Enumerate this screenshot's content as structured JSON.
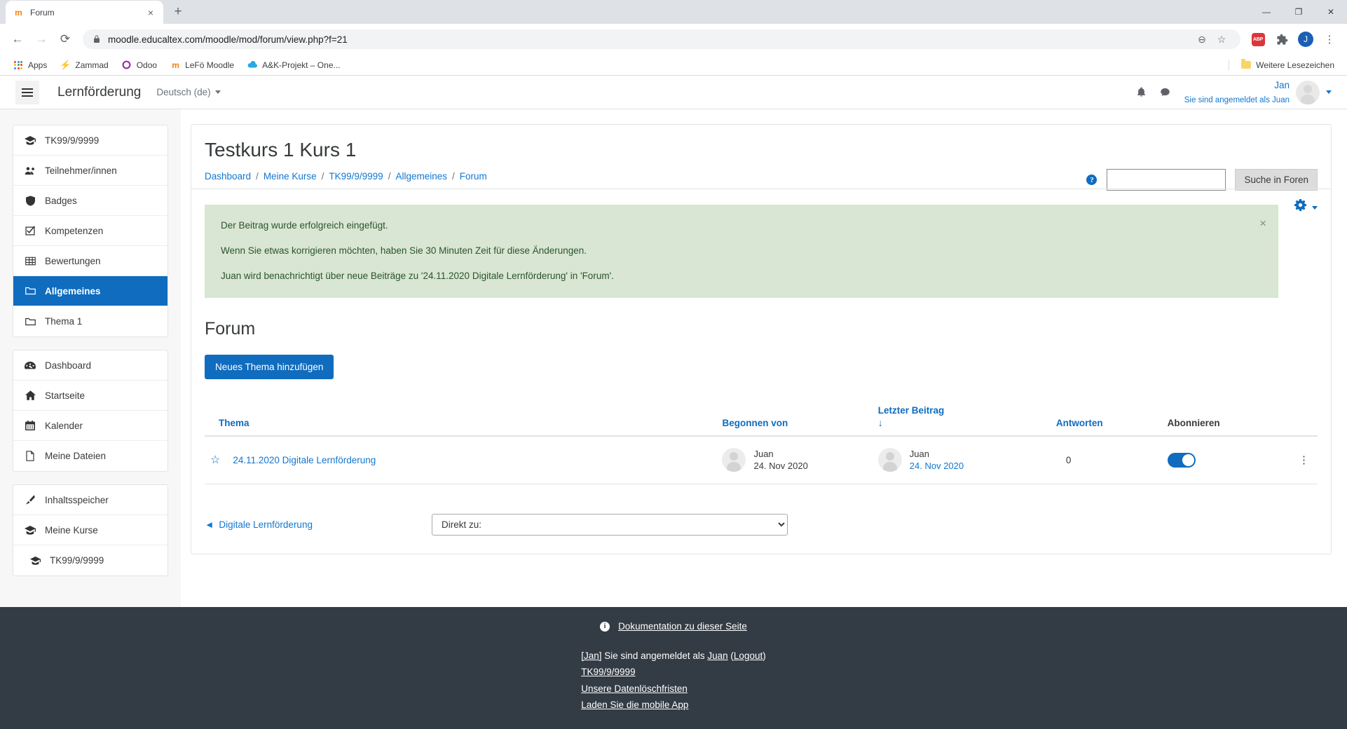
{
  "browser": {
    "tab": {
      "title": "Forum",
      "favicon": "moodle-m-icon",
      "close": "×"
    },
    "new_tab_label": "+",
    "window_controls": {
      "minimize": "—",
      "maximize": "❐",
      "close": "✕"
    },
    "nav": {
      "back": "←",
      "forward": "→",
      "reload": "⟳"
    },
    "url": "moodle.educaltex.com/moodle/mod/forum/view.php?f=21",
    "url_domain": "moodle.educaltex.com",
    "url_path": "/moodle/mod/forum/view.php?f=21",
    "omnibox_icons": {
      "lock": "lock-icon",
      "zoom_out": "⊖",
      "bookmark_star": "☆"
    },
    "toolbar_icons": {
      "adblock": "ABP",
      "extensions": "puzzle-icon",
      "profile": "J",
      "menu": "⋮"
    },
    "bookmarks": [
      {
        "label": "Apps",
        "icon": "apps-grid-icon"
      },
      {
        "label": "Zammad",
        "icon": "zammad-icon"
      },
      {
        "label": "Odoo",
        "icon": "odoo-icon"
      },
      {
        "label": "LeFö Moodle",
        "icon": "moodle-m-icon"
      },
      {
        "label": "A&K-Projekt – One...",
        "icon": "onedrive-cloud-icon"
      }
    ],
    "bookmarks_more": {
      "label": "Weitere Lesezeichen",
      "icon": "folder-icon"
    }
  },
  "navbar": {
    "menu_toggle": "hamburger-icon",
    "brand": "Lernförderung",
    "language": "Deutsch (de)",
    "notifications_icon": "bell-icon",
    "messages_icon": "chat-bubble-icon",
    "user_name": "Jan",
    "user_sub": "Sie sind angemeldet als Juan"
  },
  "sidebar": {
    "blocks": [
      {
        "items": [
          {
            "label": "TK99/9/9999",
            "icon": "graduation-cap-icon",
            "active": false,
            "sub": false
          },
          {
            "label": "Teilnehmer/innen",
            "icon": "users-icon",
            "active": false,
            "sub": false
          },
          {
            "label": "Badges",
            "icon": "shield-icon",
            "active": false,
            "sub": false
          },
          {
            "label": "Kompetenzen",
            "icon": "check-square-icon",
            "active": false,
            "sub": false
          },
          {
            "label": "Bewertungen",
            "icon": "table-icon",
            "active": false,
            "sub": false
          },
          {
            "label": "Allgemeines",
            "icon": "folder-open-icon",
            "active": true,
            "sub": false
          },
          {
            "label": "Thema 1",
            "icon": "folder-open-icon",
            "active": false,
            "sub": false
          }
        ]
      },
      {
        "items": [
          {
            "label": "Dashboard",
            "icon": "dashboard-icon",
            "active": false,
            "sub": false
          },
          {
            "label": "Startseite",
            "icon": "home-icon",
            "active": false,
            "sub": false
          },
          {
            "label": "Kalender",
            "icon": "calendar-icon",
            "active": false,
            "sub": false
          },
          {
            "label": "Meine Dateien",
            "icon": "file-icon",
            "active": false,
            "sub": false
          }
        ]
      },
      {
        "items": [
          {
            "label": "Inhaltsspeicher",
            "icon": "brush-icon",
            "active": false,
            "sub": false
          },
          {
            "label": "Meine Kurse",
            "icon": "graduation-cap-icon",
            "active": false,
            "sub": false
          },
          {
            "label": "TK99/9/9999",
            "icon": "graduation-cap-icon",
            "active": false,
            "sub": true
          }
        ]
      }
    ]
  },
  "main": {
    "page_title": "Testkurs 1 Kurs 1",
    "breadcrumb": [
      "Dashboard",
      "Meine Kurse",
      "TK99/9/9999",
      "Allgemeines",
      "Forum"
    ],
    "breadcrumb_separator": "/",
    "search": {
      "help_icon": "?",
      "value": "",
      "placeholder": "",
      "button_label": "Suche in Foren"
    },
    "gear": {
      "icon": "gear-icon",
      "caret": "▾"
    },
    "alert": {
      "close_label": "×",
      "lines": [
        "Der Beitrag wurde erfolgreich eingefügt.",
        "Wenn Sie etwas korrigieren möchten, haben Sie 30 Minuten Zeit für diese Änderungen.",
        "Juan wird benachrichtigt über neue Beiträge zu '24.11.2020 Digitale Lernförderung' in 'Forum'."
      ]
    },
    "section_title": "Forum",
    "add_topic_button": "Neues Thema hinzufügen",
    "table": {
      "headers": {
        "topic": "Thema",
        "started_by": "Begonnen von",
        "last_post": "Letzter Beitrag",
        "last_post_sort_arrow": "↓",
        "replies": "Antworten",
        "subscribe": "Abonnieren"
      },
      "rows": [
        {
          "star_icon": "star-outline-icon",
          "topic": "24.11.2020 Digitale Lernförderung",
          "started_by_name": "Juan",
          "started_by_date": "24. Nov 2020",
          "last_post_name": "Juan",
          "last_post_date": "24. Nov 2020",
          "replies": "0",
          "subscribed": true,
          "menu_icon": "kebab-menu-icon"
        }
      ]
    },
    "activity_nav": {
      "prev_arrow": "◄",
      "prev_label": "Digitale Lernförderung",
      "jump_label": "Direkt zu:"
    }
  },
  "footer": {
    "doc_icon": "info-icon",
    "doc_link": "Dokumentation zu dieser Seite",
    "login_prefix": "[Jan]",
    "login_middle": " Sie sind angemeldet als ",
    "login_user": "Juan",
    "login_open": " (",
    "logout": "Logout",
    "login_close": ")",
    "course_link": "TK99/9/9999",
    "privacy_link": "Unsere Datenlöschfristen",
    "mobile_link": "Laden Sie die mobile App"
  }
}
